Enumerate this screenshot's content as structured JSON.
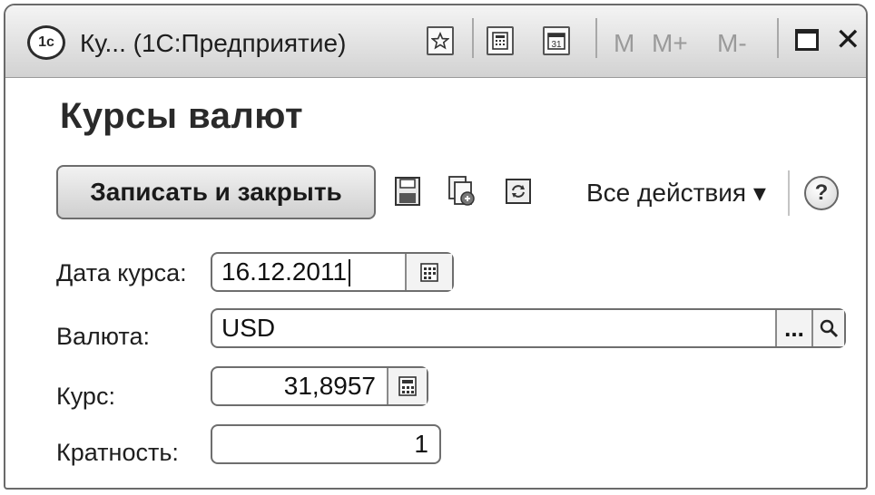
{
  "window": {
    "title": "Ку... (1С:Предприятие)",
    "logo_text": "1с",
    "memory_buttons": [
      "M",
      "M+",
      "M-"
    ]
  },
  "form": {
    "title": "Курсы валют",
    "toolbar": {
      "save_close_label": "Записать и закрыть",
      "all_actions_label": "Все действия ▾",
      "help_label": "?"
    },
    "fields": {
      "date": {
        "label": "Дата курса:",
        "value": "16.12.2011"
      },
      "currency": {
        "label": "Валюта:",
        "value": "USD",
        "select_label": "..."
      },
      "rate": {
        "label": "Курс:",
        "value": "31,8957"
      },
      "multiplicity": {
        "label": "Кратность:",
        "value": "1"
      }
    }
  },
  "icons": {
    "logo": "1c-logo-icon",
    "favorite": "star-icon",
    "calculator": "calculator-icon",
    "calendar": "calendar-icon",
    "maximize": "maximize-icon",
    "close": "close-icon",
    "save": "floppy-disk-icon",
    "copy": "copy-icon",
    "refresh": "refresh-icon",
    "search": "search-icon"
  }
}
